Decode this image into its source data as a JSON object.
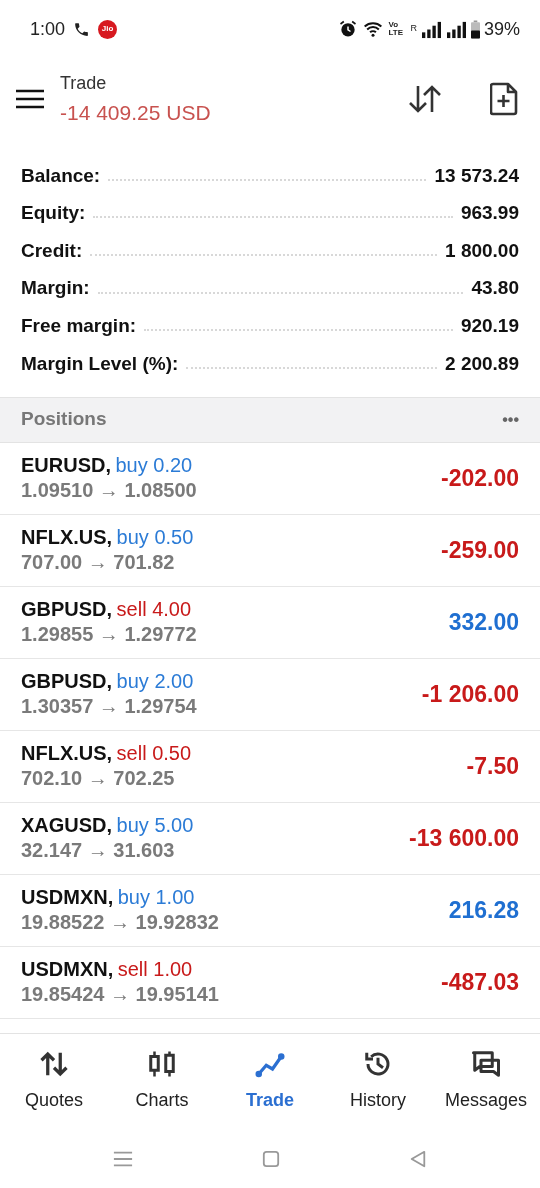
{
  "status_bar": {
    "time": "1:00",
    "carrier": "Jio",
    "volte": "Vo LTE",
    "roaming": "R",
    "battery": "39%"
  },
  "header": {
    "title": "Trade",
    "total": "-14 409.25 USD"
  },
  "summary": [
    {
      "label": "Balance:",
      "value": "13 573.24"
    },
    {
      "label": "Equity:",
      "value": "963.99"
    },
    {
      "label": "Credit:",
      "value": "1 800.00"
    },
    {
      "label": "Margin:",
      "value": "43.80"
    },
    {
      "label": "Free margin:",
      "value": "920.19"
    },
    {
      "label": "Margin Level (%):",
      "value": "2 200.89"
    }
  ],
  "positions": {
    "title": "Positions",
    "more": "•••",
    "rows": [
      {
        "symbol": "EURUSD,",
        "kind": "buy",
        "order": "buy 0.20",
        "prices": "1.09510 → 1.08500",
        "profit": "-202.00",
        "color": "#c81a1a"
      },
      {
        "symbol": "NFLX.US,",
        "kind": "buy",
        "order": "buy 0.50",
        "prices": "707.00 → 701.82",
        "profit": "-259.00",
        "color": "#c81a1a"
      },
      {
        "symbol": "GBPUSD,",
        "kind": "sell",
        "order": "sell 4.00",
        "prices": "1.29855 → 1.29772",
        "profit": "332.00",
        "color": "#1f6fd1"
      },
      {
        "symbol": "GBPUSD,",
        "kind": "buy",
        "order": "buy 2.00",
        "prices": "1.30357 → 1.29754",
        "profit": "-1 206.00",
        "color": "#c81a1a"
      },
      {
        "symbol": "NFLX.US,",
        "kind": "sell",
        "order": "sell 0.50",
        "prices": "702.10 → 702.25",
        "profit": "-7.50",
        "color": "#c81a1a"
      },
      {
        "symbol": "XAGUSD,",
        "kind": "buy",
        "order": "buy 5.00",
        "prices": "32.147 → 31.603",
        "profit": "-13 600.00",
        "color": "#c81a1a"
      },
      {
        "symbol": "USDMXN,",
        "kind": "buy",
        "order": "buy 1.00",
        "prices": "19.88522 → 19.92832",
        "profit": "216.28",
        "color": "#1f6fd1"
      },
      {
        "symbol": "USDMXN,",
        "kind": "sell",
        "order": "sell 1.00",
        "prices": "19.85424 → 19.95141",
        "profit": "-487.03",
        "color": "#c81a1a"
      }
    ]
  },
  "bottom_nav": [
    {
      "label": "Quotes",
      "selected": false
    },
    {
      "label": "Charts",
      "selected": false
    },
    {
      "label": "Trade",
      "selected": true
    },
    {
      "label": "History",
      "selected": false
    },
    {
      "label": "Messages",
      "selected": false
    }
  ]
}
